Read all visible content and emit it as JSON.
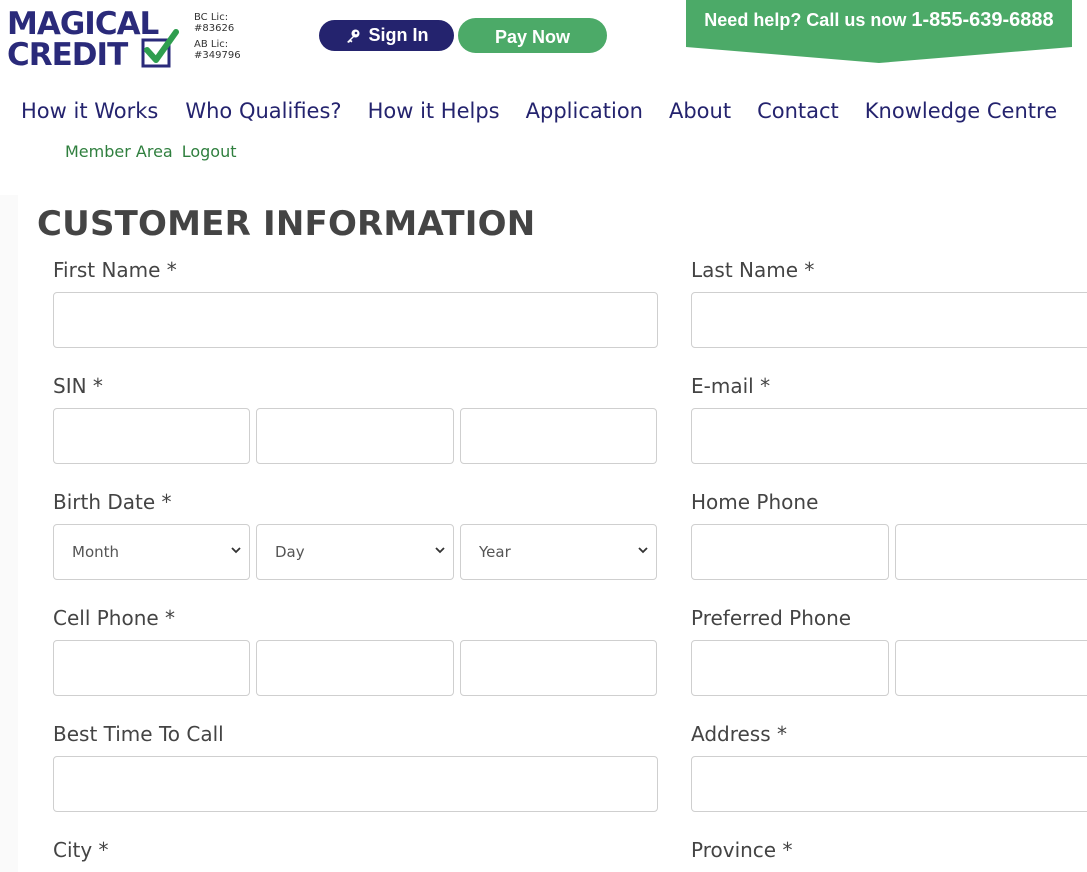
{
  "brand": {
    "logo_line1": "MAGICAL",
    "logo_line2": "CREDIT",
    "bc_license_label": "BC Lic:",
    "bc_license_number": "#83626",
    "ab_license_label": "AB Lic:",
    "ab_license_number": "#349796",
    "colors": {
      "navy": "#24236e",
      "green": "#4caa68",
      "dark_green": "#2f7f3e"
    }
  },
  "header": {
    "signin_label": "Sign In",
    "signin_icon": "key-icon",
    "pay_label": "Pay Now",
    "help_text": "Need help? Call us now",
    "help_phone": "1-855-639-6888"
  },
  "nav": {
    "items": [
      "How it Works",
      "Who Qualifies?",
      "How it Helps",
      "Application",
      "About",
      "Contact",
      "Knowledge Centre"
    ]
  },
  "subnav": {
    "member_area": "Member Area",
    "logout": "Logout"
  },
  "form": {
    "title": "CUSTOMER INFORMATION",
    "first_name": "First Name *",
    "last_name": "Last Name *",
    "sin": "SIN *",
    "email": "E-mail *",
    "birth_date": "Birth Date *",
    "month": "Month",
    "day": "Day",
    "year": "Year",
    "home_phone": "Home Phone",
    "cell_phone": "Cell Phone *",
    "preferred_phone": "Preferred Phone",
    "best_time": "Best Time To Call",
    "address": "Address *",
    "city": "City *",
    "province": "Province *"
  }
}
